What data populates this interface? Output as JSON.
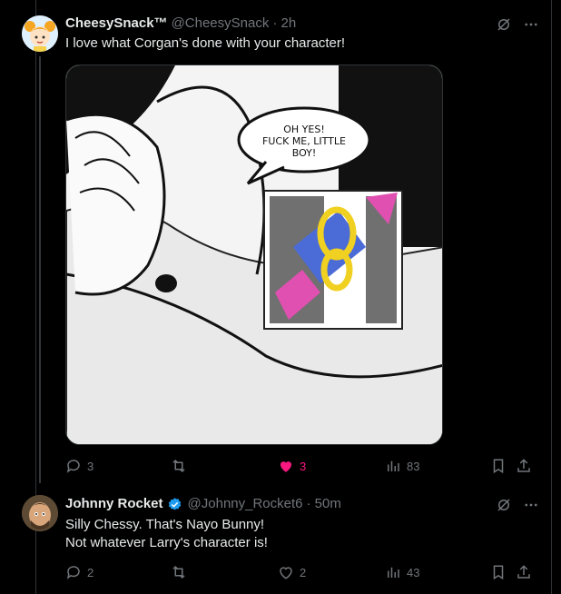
{
  "tweet1": {
    "name": "CheesySnack™",
    "handle": "@CheesySnack",
    "time": "· 2h",
    "text": "I love what Corgan's done with your character!",
    "image_text": "OH YES!\nFUCK ME, LITTLE\nBOY!",
    "actions": {
      "replies": "3",
      "likes": "3",
      "views": "83"
    }
  },
  "tweet2": {
    "name": "Johnny Rocket",
    "handle": "@Johnny_Rocket6",
    "time": "· 50m",
    "text_line1": "Silly Chessy. That's Nayo Bunny!",
    "text_line2": "Not whatever Larry's character is!",
    "actions": {
      "replies": "2",
      "likes": "2",
      "views": "43"
    }
  },
  "colors": {
    "background": "#000000",
    "text": "#e7e9ea",
    "muted": "#71767b",
    "like": "#f91880",
    "verified": "#1d9bf0"
  },
  "icons": [
    "grok-icon",
    "more-icon",
    "reply-icon",
    "retweet-icon",
    "heart-icon",
    "views-icon",
    "bookmark-icon",
    "share-icon",
    "verified-icon"
  ]
}
